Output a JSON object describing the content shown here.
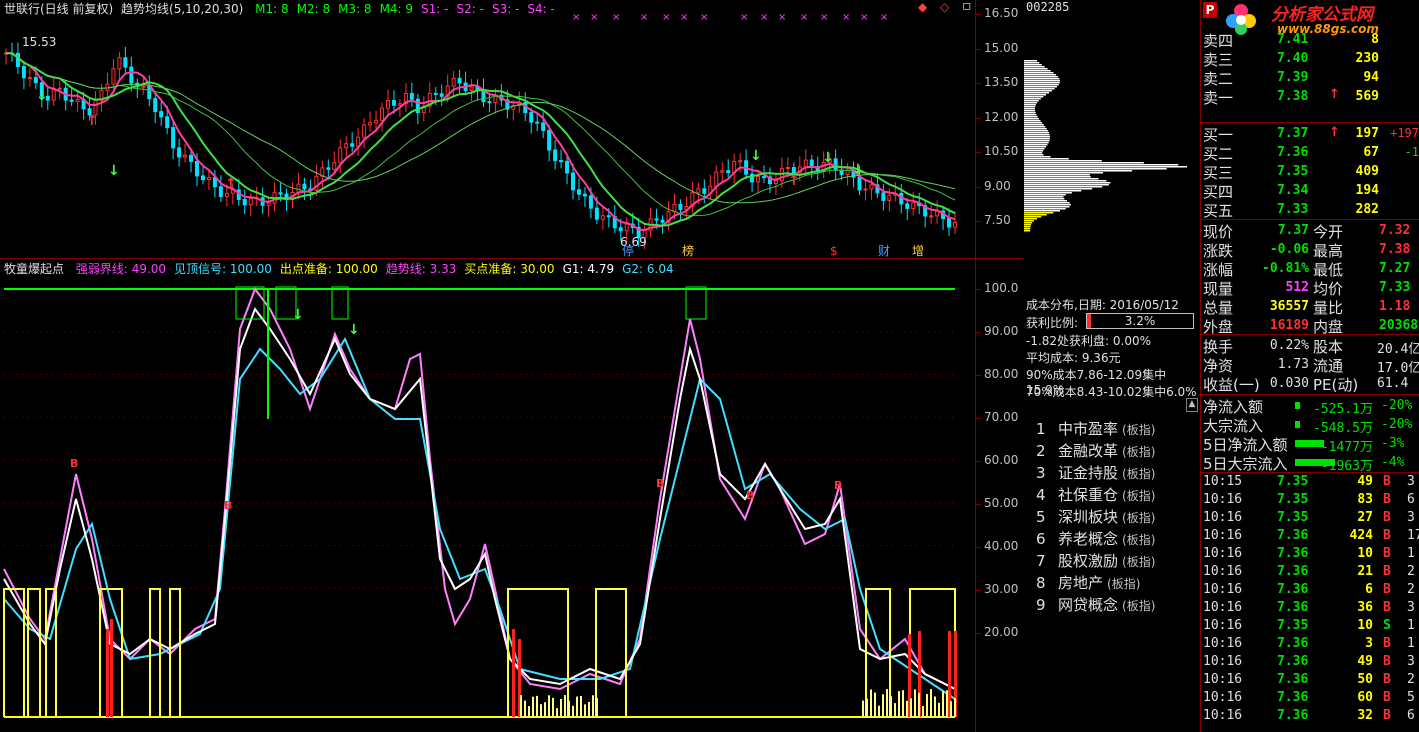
{
  "main_chart": {
    "title": "世联行(日线 前复权)",
    "indicator": "趋势均线(5,10,20,30)",
    "params": [
      {
        "label": "M1: 8",
        "color": "#00ff00"
      },
      {
        "label": "M2: 8",
        "color": "#00ff00"
      },
      {
        "label": "M3: 8",
        "color": "#00ff00"
      },
      {
        "label": "M4: 9",
        "color": "#00ff00"
      },
      {
        "label": "S1: -",
        "color": "#ff40ff"
      },
      {
        "label": "S2: -",
        "color": "#ff40ff"
      },
      {
        "label": "S3: -",
        "color": "#ff40ff"
      },
      {
        "label": "S4: -",
        "color": "#ff40ff"
      }
    ],
    "high_label": "15.53",
    "low_label": "6.69",
    "y_ticks": [
      "16.50",
      "15.00",
      "13.50",
      "12.00",
      "10.50",
      "9.00",
      "7.50"
    ],
    "bottom_marks": [
      "停",
      "榜",
      "$",
      "财",
      "增"
    ]
  },
  "sub_chart": {
    "name": "牧童爆起点",
    "params": [
      {
        "label": "强弱界线: 49.00",
        "color": "#ff40ff"
      },
      {
        "label": "见顶信号: 100.00",
        "color": "#40e0ff"
      },
      {
        "label": "出点准备: 100.00",
        "color": "#ffff00"
      },
      {
        "label": "趋势线: 3.33",
        "color": "#ff40ff"
      },
      {
        "label": "买点准备: 30.00",
        "color": "#ffff00"
      },
      {
        "label": "G1: 4.79",
        "color": "#ffffff"
      },
      {
        "label": "G2: 6.04",
        "color": "#40e0ff"
      }
    ],
    "y_ticks": [
      "100.0",
      "90.00",
      "80.00",
      "70.00",
      "60.00",
      "50.00",
      "40.00",
      "30.00",
      "20.00"
    ]
  },
  "chip": {
    "code": "002285",
    "title": "成本分布,日期: 2016/05/12",
    "profit_label": "获利比例:",
    "profit_value": "3.2%",
    "line1": "-1.82处获利盘: 0.00%",
    "line2": "平均成本: 9.36元",
    "line3": "90%成本7.86-12.09集中15.9%",
    "line4": "70%成本8.43-10.02集中6.0%"
  },
  "sectors": [
    {
      "no": "1",
      "name": "中市盈率",
      "tag": "(板指)"
    },
    {
      "no": "2",
      "name": "金融改革",
      "tag": "(板指)"
    },
    {
      "no": "3",
      "name": "证金持股",
      "tag": "(板指)"
    },
    {
      "no": "4",
      "name": "社保重仓",
      "tag": "(板指)"
    },
    {
      "no": "5",
      "name": "深圳板块",
      "tag": "(板指)"
    },
    {
      "no": "6",
      "name": "养老概念",
      "tag": "(板指)"
    },
    {
      "no": "7",
      "name": "股权激励",
      "tag": "(板指)"
    },
    {
      "no": "8",
      "name": "房地产",
      "tag": "(板指)"
    },
    {
      "no": "9",
      "name": "网贷概念",
      "tag": "(板指)"
    }
  ],
  "quote": {
    "header_code": "002285",
    "brand": "分析家公式网",
    "brand_url": "www.88gs.com",
    "sells": [
      {
        "label": "卖四",
        "price": "7.41",
        "vol": "8"
      },
      {
        "label": "卖三",
        "price": "7.40",
        "vol": "230"
      },
      {
        "label": "卖二",
        "price": "7.39",
        "vol": "94"
      },
      {
        "label": "卖一",
        "price": "7.38",
        "vol": "569"
      }
    ],
    "buys": [
      {
        "label": "买一",
        "price": "7.37",
        "vol": "197",
        "extra": "+197"
      },
      {
        "label": "买二",
        "price": "7.36",
        "vol": "67",
        "extra": "-1"
      },
      {
        "label": "买三",
        "price": "7.35",
        "vol": "409",
        "extra": ""
      },
      {
        "label": "买四",
        "price": "7.34",
        "vol": "194",
        "extra": ""
      },
      {
        "label": "买五",
        "price": "7.33",
        "vol": "282",
        "extra": ""
      }
    ],
    "stats": [
      {
        "l1": "现价",
        "v1": "7.37",
        "l2": "今开",
        "v2": "7.32"
      },
      {
        "l1": "涨跌",
        "v1": "-0.06",
        "l2": "最高",
        "v2": "7.38"
      },
      {
        "l1": "涨幅",
        "v1": "-0.81%",
        "l2": "最低",
        "v2": "7.27"
      },
      {
        "l1": "现量",
        "v1": "512",
        "l2": "均价",
        "v2": "7.33"
      },
      {
        "l1": "总量",
        "v1": "36557",
        "l2": "量比",
        "v2": "1.18"
      },
      {
        "l1": "外盘",
        "v1": "16189",
        "l2": "内盘",
        "v2": "20368"
      }
    ],
    "fund": [
      {
        "l1": "换手",
        "v1": "0.22%",
        "l2": "股本",
        "v2": "20.4亿"
      },
      {
        "l1": "净资",
        "v1": "1.73",
        "l2": "流通",
        "v2": "17.0亿"
      },
      {
        "l1": "收益(一)",
        "v1": "0.030",
        "l2": "PE(动)",
        "v2": "61.4"
      }
    ],
    "flows": [
      {
        "label": "净流入额",
        "value": "-525.1万",
        "pct": "-20%",
        "bar": 0.1
      },
      {
        "label": "大宗流入",
        "value": "-548.5万",
        "pct": "-20%",
        "bar": 0.1
      },
      {
        "label": "5日净流入额",
        "value": "-1477万",
        "pct": "-3%",
        "bar": 0.7
      },
      {
        "label": "5日大宗流入",
        "value": "-1963万",
        "pct": "-4%",
        "bar": 0.95
      }
    ],
    "ticks": [
      {
        "time": "10:15",
        "price": "7.35",
        "vol": "49",
        "bs": "B",
        "n": "3"
      },
      {
        "time": "10:16",
        "price": "7.35",
        "vol": "83",
        "bs": "B",
        "n": "6"
      },
      {
        "time": "10:16",
        "price": "7.35",
        "vol": "27",
        "bs": "B",
        "n": "3"
      },
      {
        "time": "10:16",
        "price": "7.36",
        "vol": "424",
        "bs": "B",
        "n": "17"
      },
      {
        "time": "10:16",
        "price": "7.36",
        "vol": "10",
        "bs": "B",
        "n": "1"
      },
      {
        "time": "10:16",
        "price": "7.36",
        "vol": "21",
        "bs": "B",
        "n": "2"
      },
      {
        "time": "10:16",
        "price": "7.36",
        "vol": "6",
        "bs": "B",
        "n": "2"
      },
      {
        "time": "10:16",
        "price": "7.36",
        "vol": "36",
        "bs": "B",
        "n": "3"
      },
      {
        "time": "10:16",
        "price": "7.35",
        "vol": "10",
        "bs": "S",
        "n": "1"
      },
      {
        "time": "10:16",
        "price": "7.36",
        "vol": "3",
        "bs": "B",
        "n": "1"
      },
      {
        "time": "10:16",
        "price": "7.36",
        "vol": "49",
        "bs": "B",
        "n": "3"
      },
      {
        "time": "10:16",
        "price": "7.36",
        "vol": "50",
        "bs": "B",
        "n": "2"
      },
      {
        "time": "10:16",
        "price": "7.36",
        "vol": "60",
        "bs": "B",
        "n": "5"
      },
      {
        "time": "10:16",
        "price": "7.36",
        "vol": "32",
        "bs": "B",
        "n": "6"
      }
    ]
  }
}
